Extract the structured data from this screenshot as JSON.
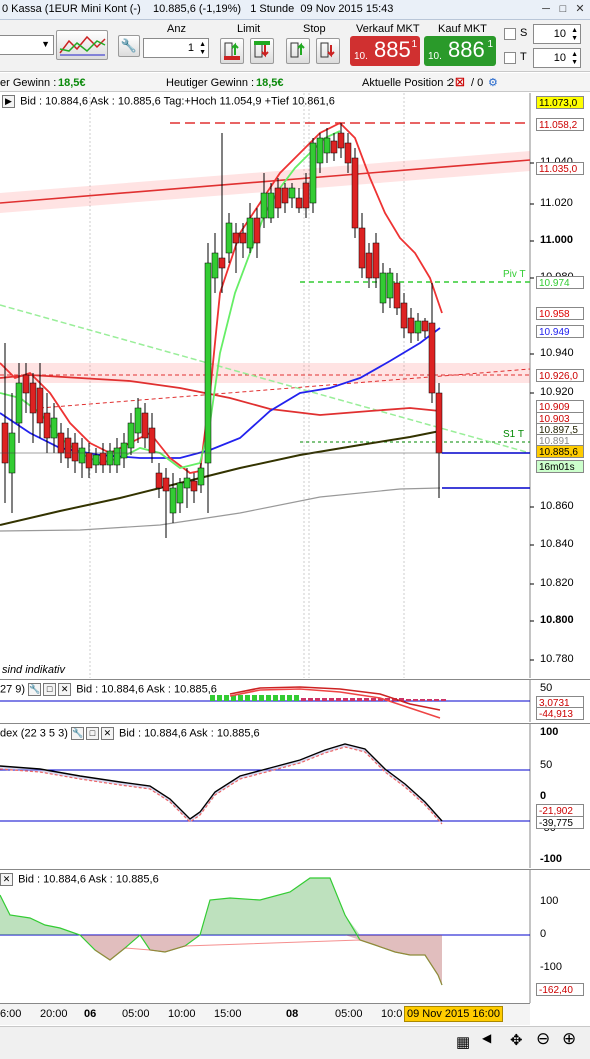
{
  "window": {
    "title": "0 Kassa (1EUR Mini Kont (-)",
    "quote": "10.885,6 (-1,19%)",
    "timeframe": "1 Stunde",
    "datetime": "09 Nov 2015 15:43"
  },
  "toolbar": {
    "anz_label": "Anz",
    "anz_value": "1",
    "limit_label": "Limit",
    "stop_label": "Stop",
    "sell_label": "Verkauf MKT",
    "buy_label": "Kauf MKT",
    "sell_price_small": "10.",
    "sell_price_big": "885",
    "sell_price_sup": "1",
    "buy_price_small": "10.",
    "buy_price_big": "886",
    "buy_price_sup": "1",
    "s_label": "S",
    "t_label": "T",
    "s_value": "10",
    "t_value": "10"
  },
  "status": {
    "gewinn_label": "er Gewinn :",
    "gewinn_value": "18,5€",
    "heute_label": "Heutiger Gewinn :",
    "heute_value": "18,5€",
    "position_label": "Aktuelle Position :",
    "position_value": "2",
    "position_sep": "/ 0"
  },
  "main_legend": "Bid : 10.884,6 Ask : 10.885,6 Tag:+Hoch 11.054,9 +Tief 10.861,6",
  "main_axis": [
    "11.040",
    "11.020",
    "11.000",
    "10.980",
    "10.940",
    "10.920",
    "10.860",
    "10.840",
    "10.820",
    "10.800",
    "10.780"
  ],
  "main_tags": [
    {
      "text": "11.073,0",
      "bg": "#ffff00",
      "fg": "#000000"
    },
    {
      "text": "11.058,2",
      "bg": "#ffffff",
      "fg": "#cc0000"
    },
    {
      "text": "11.035,0",
      "bg": "#ffffff",
      "fg": "#cc0000"
    },
    {
      "text": "10.974",
      "bg": "#ffffff",
      "fg": "#33cc33"
    },
    {
      "text": "10.958",
      "bg": "#ffffff",
      "fg": "#dd0000"
    },
    {
      "text": "10.949",
      "bg": "#ffffff",
      "fg": "#2222ee"
    },
    {
      "text": "10.926,0",
      "bg": "#ffffff",
      "fg": "#cc0000"
    },
    {
      "text": "10.909",
      "bg": "#ffffff",
      "fg": "#cc0000"
    },
    {
      "text": "10.903",
      "bg": "#ffffff",
      "fg": "#cc0000"
    },
    {
      "text": "10.897,5",
      "bg": "#ffffff",
      "fg": "#222200"
    },
    {
      "text": "10.891",
      "bg": "#ffffff",
      "fg": "#888888"
    },
    {
      "text": "10.885,6",
      "bg": "#ffcc00",
      "fg": "#000000"
    },
    {
      "text": "16m01s",
      "bg": "#ccffcc",
      "fg": "#000000"
    }
  ],
  "piv_label": "Piv T",
  "s1_label": "S1 T",
  "note": "sind indikativ",
  "ind1": {
    "legend_prefix": "27 9)",
    "legend_bid": "Bid : 10.884,6 Ask : 10.885,6",
    "axis": "50",
    "tag1": "3,0731",
    "tag2": "-44,913"
  },
  "ind2": {
    "legend_prefix": "dex (22 3 5 3)",
    "legend_bid": "Bid : 10.884,6 Ask : 10.885,6",
    "axis": [
      "100",
      "50",
      "0",
      "-50",
      "-100"
    ],
    "tag1": "-21,902",
    "tag2": "-39,775"
  },
  "ind3": {
    "legend_bid": "Bid : 10.884,6 Ask : 10.885,6",
    "axis": [
      "100",
      "0",
      "-100"
    ],
    "tag1": "-162,40"
  },
  "time_axis": [
    "6:00",
    "20:00",
    "06",
    "05:00",
    "10:00",
    "15:00",
    "08",
    "05:00",
    "10:0"
  ],
  "time_highlight": "09 Nov 2015 16:00",
  "colors": {
    "bull": "#33cc33",
    "bear": "#dd2222",
    "sell_button": "#d03030",
    "buy_button": "#2a9a2a"
  }
}
